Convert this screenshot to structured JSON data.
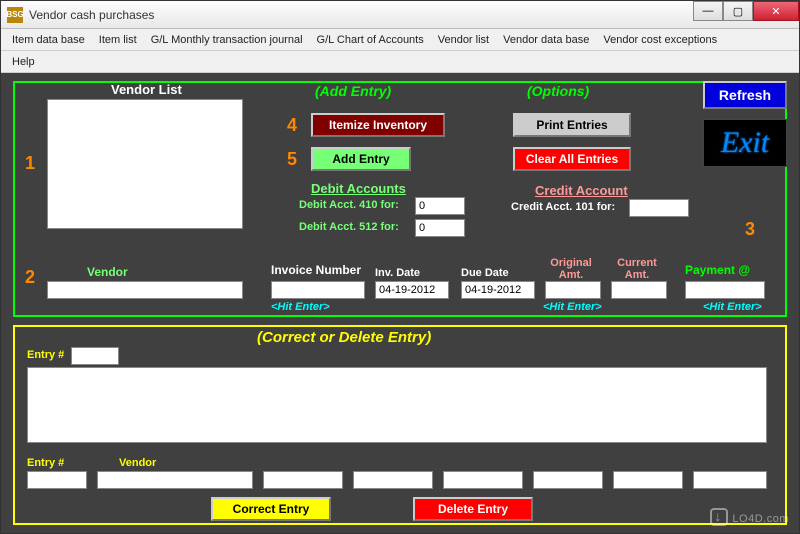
{
  "window": {
    "title": "Vendor cash purchases",
    "icon_text": "BSG"
  },
  "winbtns": {
    "min": "—",
    "max": "▢",
    "close": "✕"
  },
  "menu": {
    "items": [
      "Item data base",
      "Item list",
      "G/L Monthly transaction journal",
      "G/L Chart of Accounts",
      "Vendor list",
      "Vendor data base",
      "Vendor cost exceptions"
    ],
    "help": "Help"
  },
  "top": {
    "vendor_list_label": "Vendor List",
    "add_entry_heading": "(Add Entry)",
    "options_heading": "(Options)",
    "num1": "1",
    "num2": "2",
    "num3": "3",
    "num4": "4",
    "num5": "5",
    "itemize_btn": "Itemize Inventory",
    "add_entry_btn": "Add Entry",
    "print_btn": "Print Entries",
    "clear_btn": "Clear All Entries",
    "refresh_btn": "Refresh",
    "exit_btn": "Exit",
    "debit_heading": "Debit Accounts",
    "debit410": "Debit Acct. 410 for:",
    "debit512": "Debit Acct. 512 for:",
    "debit410_val": "0",
    "debit512_val": "0",
    "credit_heading": "Credit Account",
    "credit101": "Credit Acct. 101 for:",
    "credit101_val": "",
    "vendor_label": "Vendor",
    "vendor_val": "",
    "invoice_label": "Invoice Number",
    "invoice_val": "",
    "hit_enter": "<Hit Enter>",
    "inv_date_label": "Inv. Date",
    "inv_date_val": "04-19-2012",
    "due_date_label": "Due Date",
    "due_date_val": "04-19-2012",
    "orig_amt_label": "Original Amt.",
    "orig_amt_val": "",
    "curr_amt_label": "Current Amt.",
    "curr_amt_val": "",
    "payment_label": "Payment @",
    "payment_val": ""
  },
  "bottom": {
    "heading": "(Correct or Delete Entry)",
    "entry_no_label": "Entry #",
    "entry_no_val": "",
    "list_val": "",
    "entry_no2_label": "Entry #",
    "entry_no2_val": "",
    "vendor_label": "Vendor",
    "vendor_val": "",
    "f1": "",
    "f2": "",
    "f3": "",
    "f4": "",
    "f5": "",
    "f6": "",
    "correct_btn": "Correct Entry",
    "delete_btn": "Delete Entry"
  },
  "watermark": "LO4D.com"
}
